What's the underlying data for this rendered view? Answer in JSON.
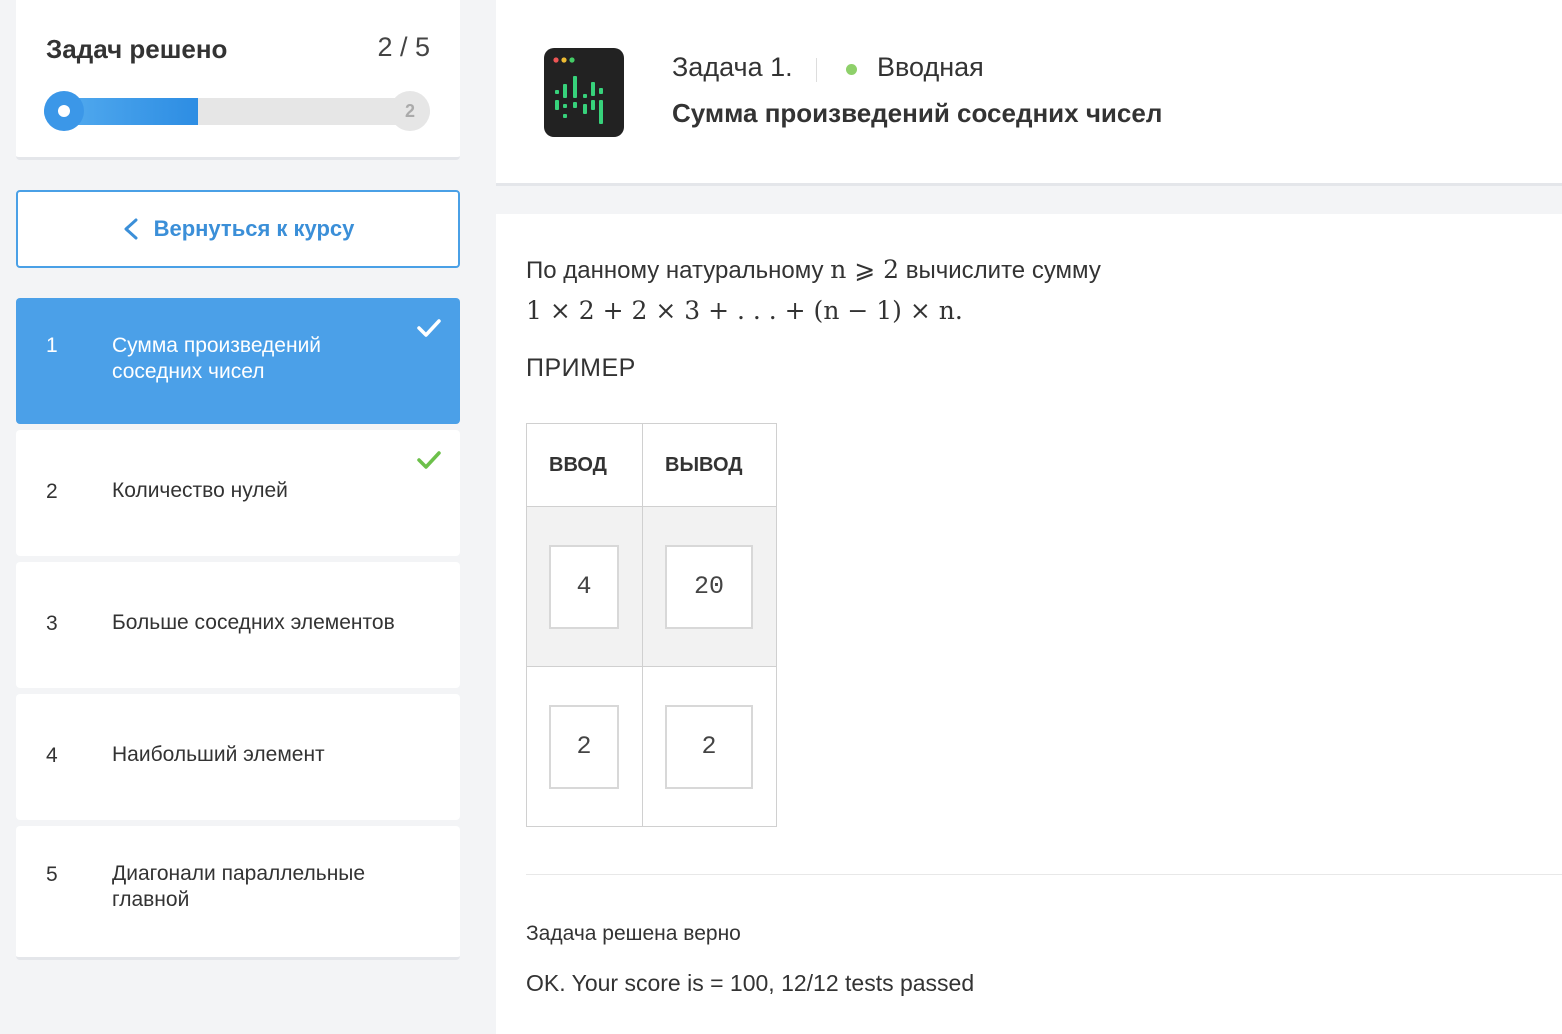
{
  "progress": {
    "label": "Задач решено",
    "count": "2 / 5",
    "solved": 2,
    "total": 5,
    "marker": "2"
  },
  "back_button": {
    "label": "Вернуться к курсу"
  },
  "tasks": [
    {
      "num": "1",
      "title": "Сумма произведений соседних чисел",
      "solved": true,
      "active": true
    },
    {
      "num": "2",
      "title": "Количество нулей",
      "solved": true,
      "active": false
    },
    {
      "num": "3",
      "title": "Больше соседних элементов",
      "solved": false,
      "active": false
    },
    {
      "num": "4",
      "title": "Наибольший элемент",
      "solved": false,
      "active": false
    },
    {
      "num": "5",
      "title": "Диагонали параллельные главной",
      "solved": false,
      "active": false
    }
  ],
  "header": {
    "task_number": "Задача 1.",
    "level": "Вводная",
    "title": "Сумма произведений соседних чисел"
  },
  "statement": {
    "text_before": "По данному натуральному",
    "condition": "n ⩾ 2",
    "text_after": "вычислите сумму",
    "formula": "1 × 2 + 2 × 3 + . . . + (n − 1) × n."
  },
  "example": {
    "heading": "ПРИМЕР",
    "columns": [
      "ВВОД",
      "ВЫВОД"
    ],
    "rows": [
      [
        "4",
        "20"
      ],
      [
        "2",
        "2"
      ]
    ]
  },
  "result": {
    "status": "Задача решена верно",
    "message": "OK. Your score is = 100, 12/12 tests passed"
  },
  "colors": {
    "accent": "#4ba0e8",
    "success": "#8ed06a",
    "background": "#f3f4f6"
  }
}
